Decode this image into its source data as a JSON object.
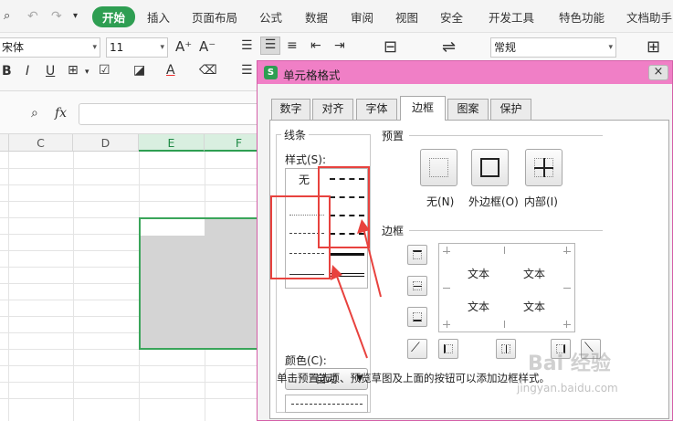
{
  "menubar": {
    "tabs": [
      "开始",
      "插入",
      "页面布局",
      "公式",
      "数据",
      "审阅",
      "视图",
      "安全",
      "开发工具",
      "特色功能",
      "文档助手"
    ],
    "active_tab": "开始"
  },
  "toolbar": {
    "font_name": "宋体",
    "font_size": "11",
    "bold": "B",
    "italic": "I",
    "underline": "U",
    "grow_font": "A⁺",
    "shrink_font": "A⁻",
    "font_color_glyph": "A",
    "number_format": "常规"
  },
  "formula_bar": {
    "fx_label": "fx",
    "value": ""
  },
  "grid": {
    "columns": [
      "C",
      "D",
      "E",
      "F"
    ],
    "selected_columns": [
      "E",
      "F"
    ]
  },
  "dialog": {
    "title": "单元格格式",
    "close": "×",
    "tabs": [
      "数字",
      "对齐",
      "字体",
      "边框",
      "图案",
      "保护"
    ],
    "active_tab": "边框",
    "line_group_label": "线条",
    "style_label": "样式(S):",
    "style_none": "无",
    "color_label": "颜色(C):",
    "color_value": "自动",
    "preset_label": "预置",
    "preset_buttons": [
      "无(N)",
      "外边框(O)",
      "内部(I)"
    ],
    "border_label": "边框",
    "preview_texts": [
      "文本",
      "文本",
      "文本",
      "文本"
    ],
    "hint": "单击预置选项、预览草图及上面的按钮可以添加边框样式。"
  },
  "watermark": {
    "text": "Bai 经验",
    "sub": "jingyan.baidu.com"
  },
  "colors": {
    "accent_green": "#2e9e52",
    "dialog_title_pink": "#f07fc6",
    "annotation_red": "#e8423e"
  }
}
